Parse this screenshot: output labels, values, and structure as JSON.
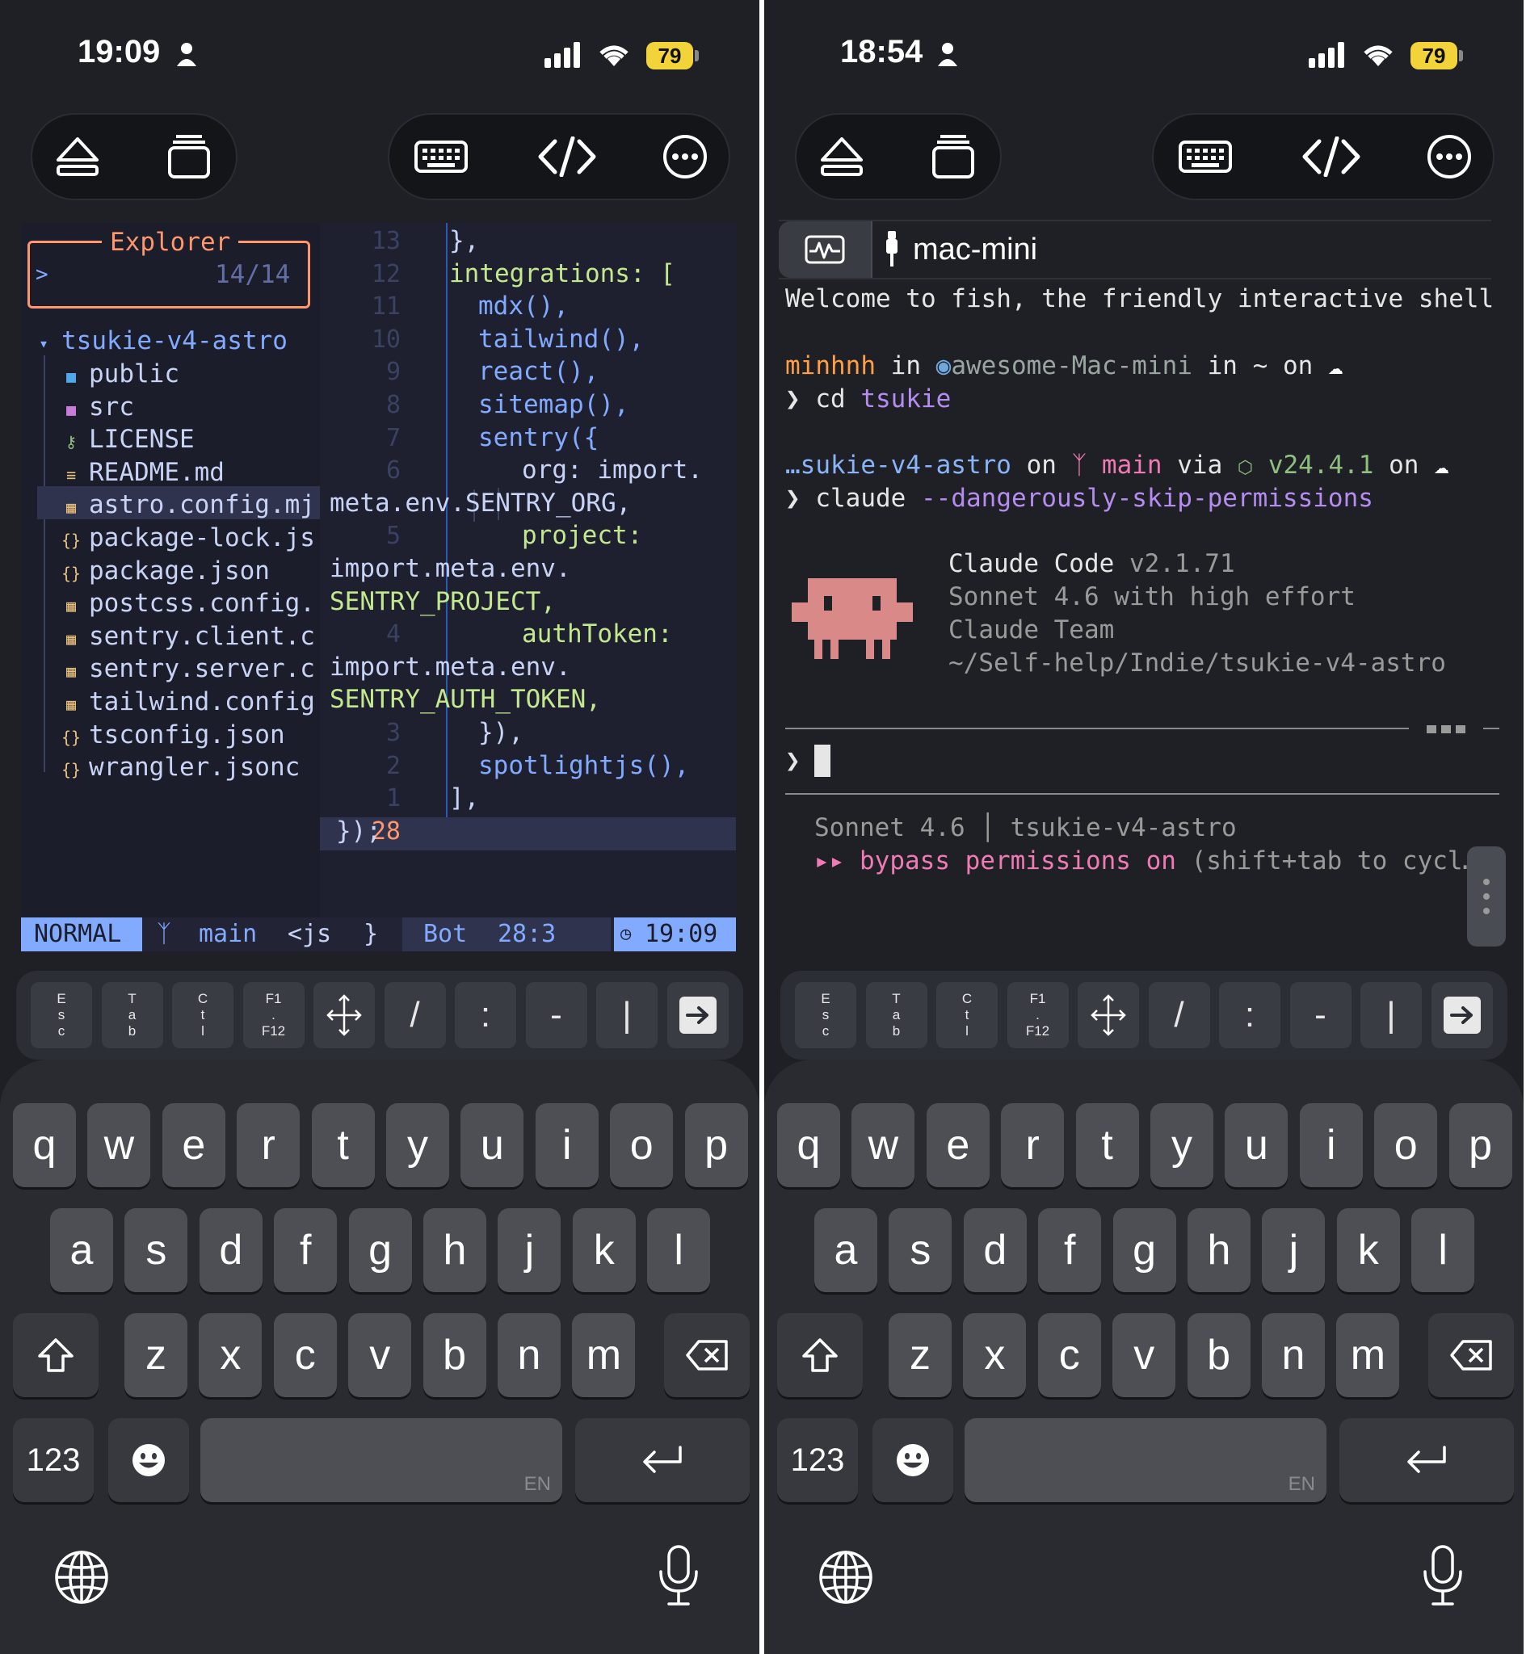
{
  "left": {
    "status": {
      "time": "19:09",
      "battery": "79"
    },
    "explorer": {
      "title": "Explorer",
      "prompt": ">",
      "count": "14/14",
      "root": "tsukie-v4-astro",
      "items": [
        {
          "name": "public",
          "icon": "folder-icon"
        },
        {
          "name": "src",
          "icon": "folder-icon"
        },
        {
          "name": "LICENSE",
          "icon": "key-icon"
        },
        {
          "name": "README.md",
          "icon": "markdown-icon"
        },
        {
          "name": "astro.config.mj",
          "icon": "js-file-icon"
        },
        {
          "name": "package-lock.js",
          "icon": "json-file-icon"
        },
        {
          "name": "package.json",
          "icon": "json-file-icon"
        },
        {
          "name": "postcss.config.",
          "icon": "js-file-icon"
        },
        {
          "name": "sentry.client.c",
          "icon": "js-file-icon"
        },
        {
          "name": "sentry.server.c",
          "icon": "js-file-icon"
        },
        {
          "name": "tailwind.config",
          "icon": "js-file-icon"
        },
        {
          "name": "tsconfig.json",
          "icon": "json-file-icon"
        },
        {
          "name": "wrangler.jsonc",
          "icon": "json-file-icon"
        }
      ]
    },
    "editor": {
      "line_numbers": [
        "13",
        "12",
        "11",
        "10",
        "9",
        "8",
        "7",
        "6",
        "",
        "5",
        "",
        "",
        "4",
        "",
        "",
        "3",
        "2",
        "1",
        "28"
      ],
      "lines": [
        "},",
        "integrations: [",
        "mdx(),",
        "tailwind(),",
        "react(),",
        "sitemap(),",
        "sentry({",
        "org: import.",
        "meta.env.SENTRY_ORG,",
        "project:",
        "import.meta.env.",
        "SENTRY_PROJECT,",
        "authToken:",
        "import.meta.env.",
        "SENTRY_AUTH_TOKEN,",
        "}),",
        "spotlightjs(),",
        "],",
        "});"
      ]
    },
    "statusline": {
      "mode": "NORMAL",
      "branch": "main",
      "filetype": "<js",
      "brace": "}",
      "position_label": "Bot",
      "cursor": "28:3",
      "clock": "19:09"
    }
  },
  "right": {
    "status": {
      "time": "18:54",
      "battery": "79"
    },
    "tab": {
      "host": "mac-mini"
    },
    "terminal": {
      "welcome": "Welcome to fish, the friendly interactive shell",
      "user": "minhnh",
      "in1": "in",
      "hostname": "awesome-Mac-mini",
      "in2": "in ~ on",
      "cmd1_prompt": "❯",
      "cmd1": "cd",
      "cmd1_arg": "tsukie",
      "dir": "…sukie-v4-astro",
      "on": "on",
      "branch": "main",
      "via": "via",
      "node": "v24.4.1",
      "on2": "on",
      "cmd2": "claude",
      "cmd2_arg": "--dangerously-skip-permissions",
      "claude_title": "Claude Code",
      "claude_version": "v2.1.71",
      "claude_model": "Sonnet 4.6 with high effort",
      "claude_team": "Claude Team",
      "claude_path": "~/Self-help/Indie/tsukie-v4-astro",
      "input_prompt": "❯",
      "footer_model": "Sonnet 4.6",
      "footer_sep": "│",
      "footer_project": "tsukie-v4-astro",
      "bypass_arrows": "▸▸",
      "bypass_text": "bypass permissions on",
      "bypass_hint": "(shift+tab to cycl…"
    }
  },
  "extra_keys": [
    {
      "label": "E\ns\nc",
      "name": "esc-key"
    },
    {
      "label": "T\na\nb",
      "name": "tab-key"
    },
    {
      "label": "C\nt\nl",
      "name": "ctrl-key"
    },
    {
      "label": "F1\n.\nF12",
      "name": "function-keys"
    },
    {
      "label": "",
      "name": "arrows-key"
    },
    {
      "label": "/",
      "name": "slash-key"
    },
    {
      "label": ":",
      "name": "colon-key"
    },
    {
      "label": "-",
      "name": "dash-key"
    },
    {
      "label": "|",
      "name": "pipe-key"
    },
    {
      "label": "",
      "name": "enter-arrow-key"
    }
  ],
  "keyboard": {
    "row1": [
      "q",
      "w",
      "e",
      "r",
      "t",
      "y",
      "u",
      "i",
      "o",
      "p"
    ],
    "row2": [
      "a",
      "s",
      "d",
      "f",
      "g",
      "h",
      "j",
      "k",
      "l"
    ],
    "row3": [
      "z",
      "x",
      "c",
      "v",
      "b",
      "n",
      "m"
    ],
    "numbers": "123",
    "space_lang": "EN"
  },
  "colors": {
    "bg": "#1f2026",
    "editor_bg": "#1e2030",
    "accent_blue": "#82aaff",
    "accent_orange": "#ff966c",
    "accent_green": "#c3e88d",
    "claude_pink": "#d98a88",
    "bypass_pink": "#f07ab4"
  }
}
